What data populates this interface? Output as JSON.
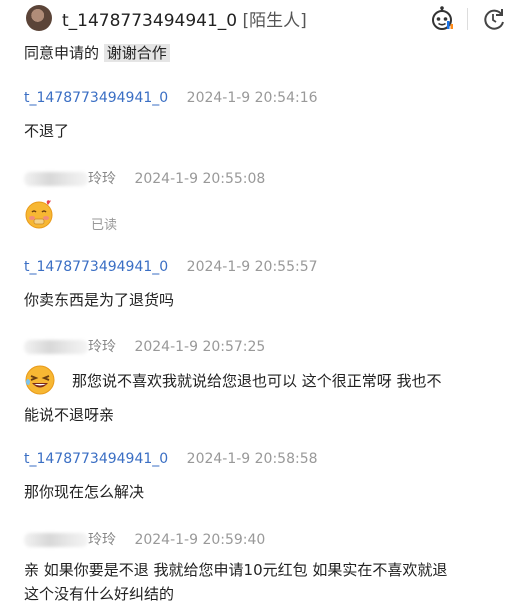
{
  "header": {
    "username": "t_1478773494941_0",
    "tag": "[陌生人]",
    "robot_icon": "robot-icon",
    "refresh_icon": "refresh-icon"
  },
  "messages": {
    "m0": {
      "text_plain": "同意申请的",
      "text_highlight": "谢谢合作"
    },
    "m1": {
      "sender": "t_1478773494941_0",
      "time": "2024-1-9 20:54:16",
      "text": "不退了"
    },
    "m2": {
      "sender_suffix": "玲玲",
      "time": "2024-1-9 20:55:08",
      "emoji": "blush-emoji",
      "status": "已读"
    },
    "m3": {
      "sender": "t_1478773494941_0",
      "time": "2024-1-9 20:55:57",
      "text": "你卖东西是为了退货吗"
    },
    "m4": {
      "sender_suffix": "玲玲",
      "time": "2024-1-9 20:57:25",
      "emoji": "laughing-emoji",
      "line1": "那您说不喜欢我就说给您退也可以 这个很正常呀   我也不",
      "line2": "能说不退呀亲"
    },
    "m5": {
      "sender": "t_1478773494941_0",
      "time": "2024-1-9 20:58:58",
      "text": "那你现在怎么解决"
    },
    "m6": {
      "sender_suffix": "玲玲",
      "time": "2024-1-9 20:59:40",
      "line1": "亲 如果你要是不退 我就给您申请10元红包 如果实在不喜欢就退",
      "line2": "这个没有什么好纠结的"
    }
  }
}
